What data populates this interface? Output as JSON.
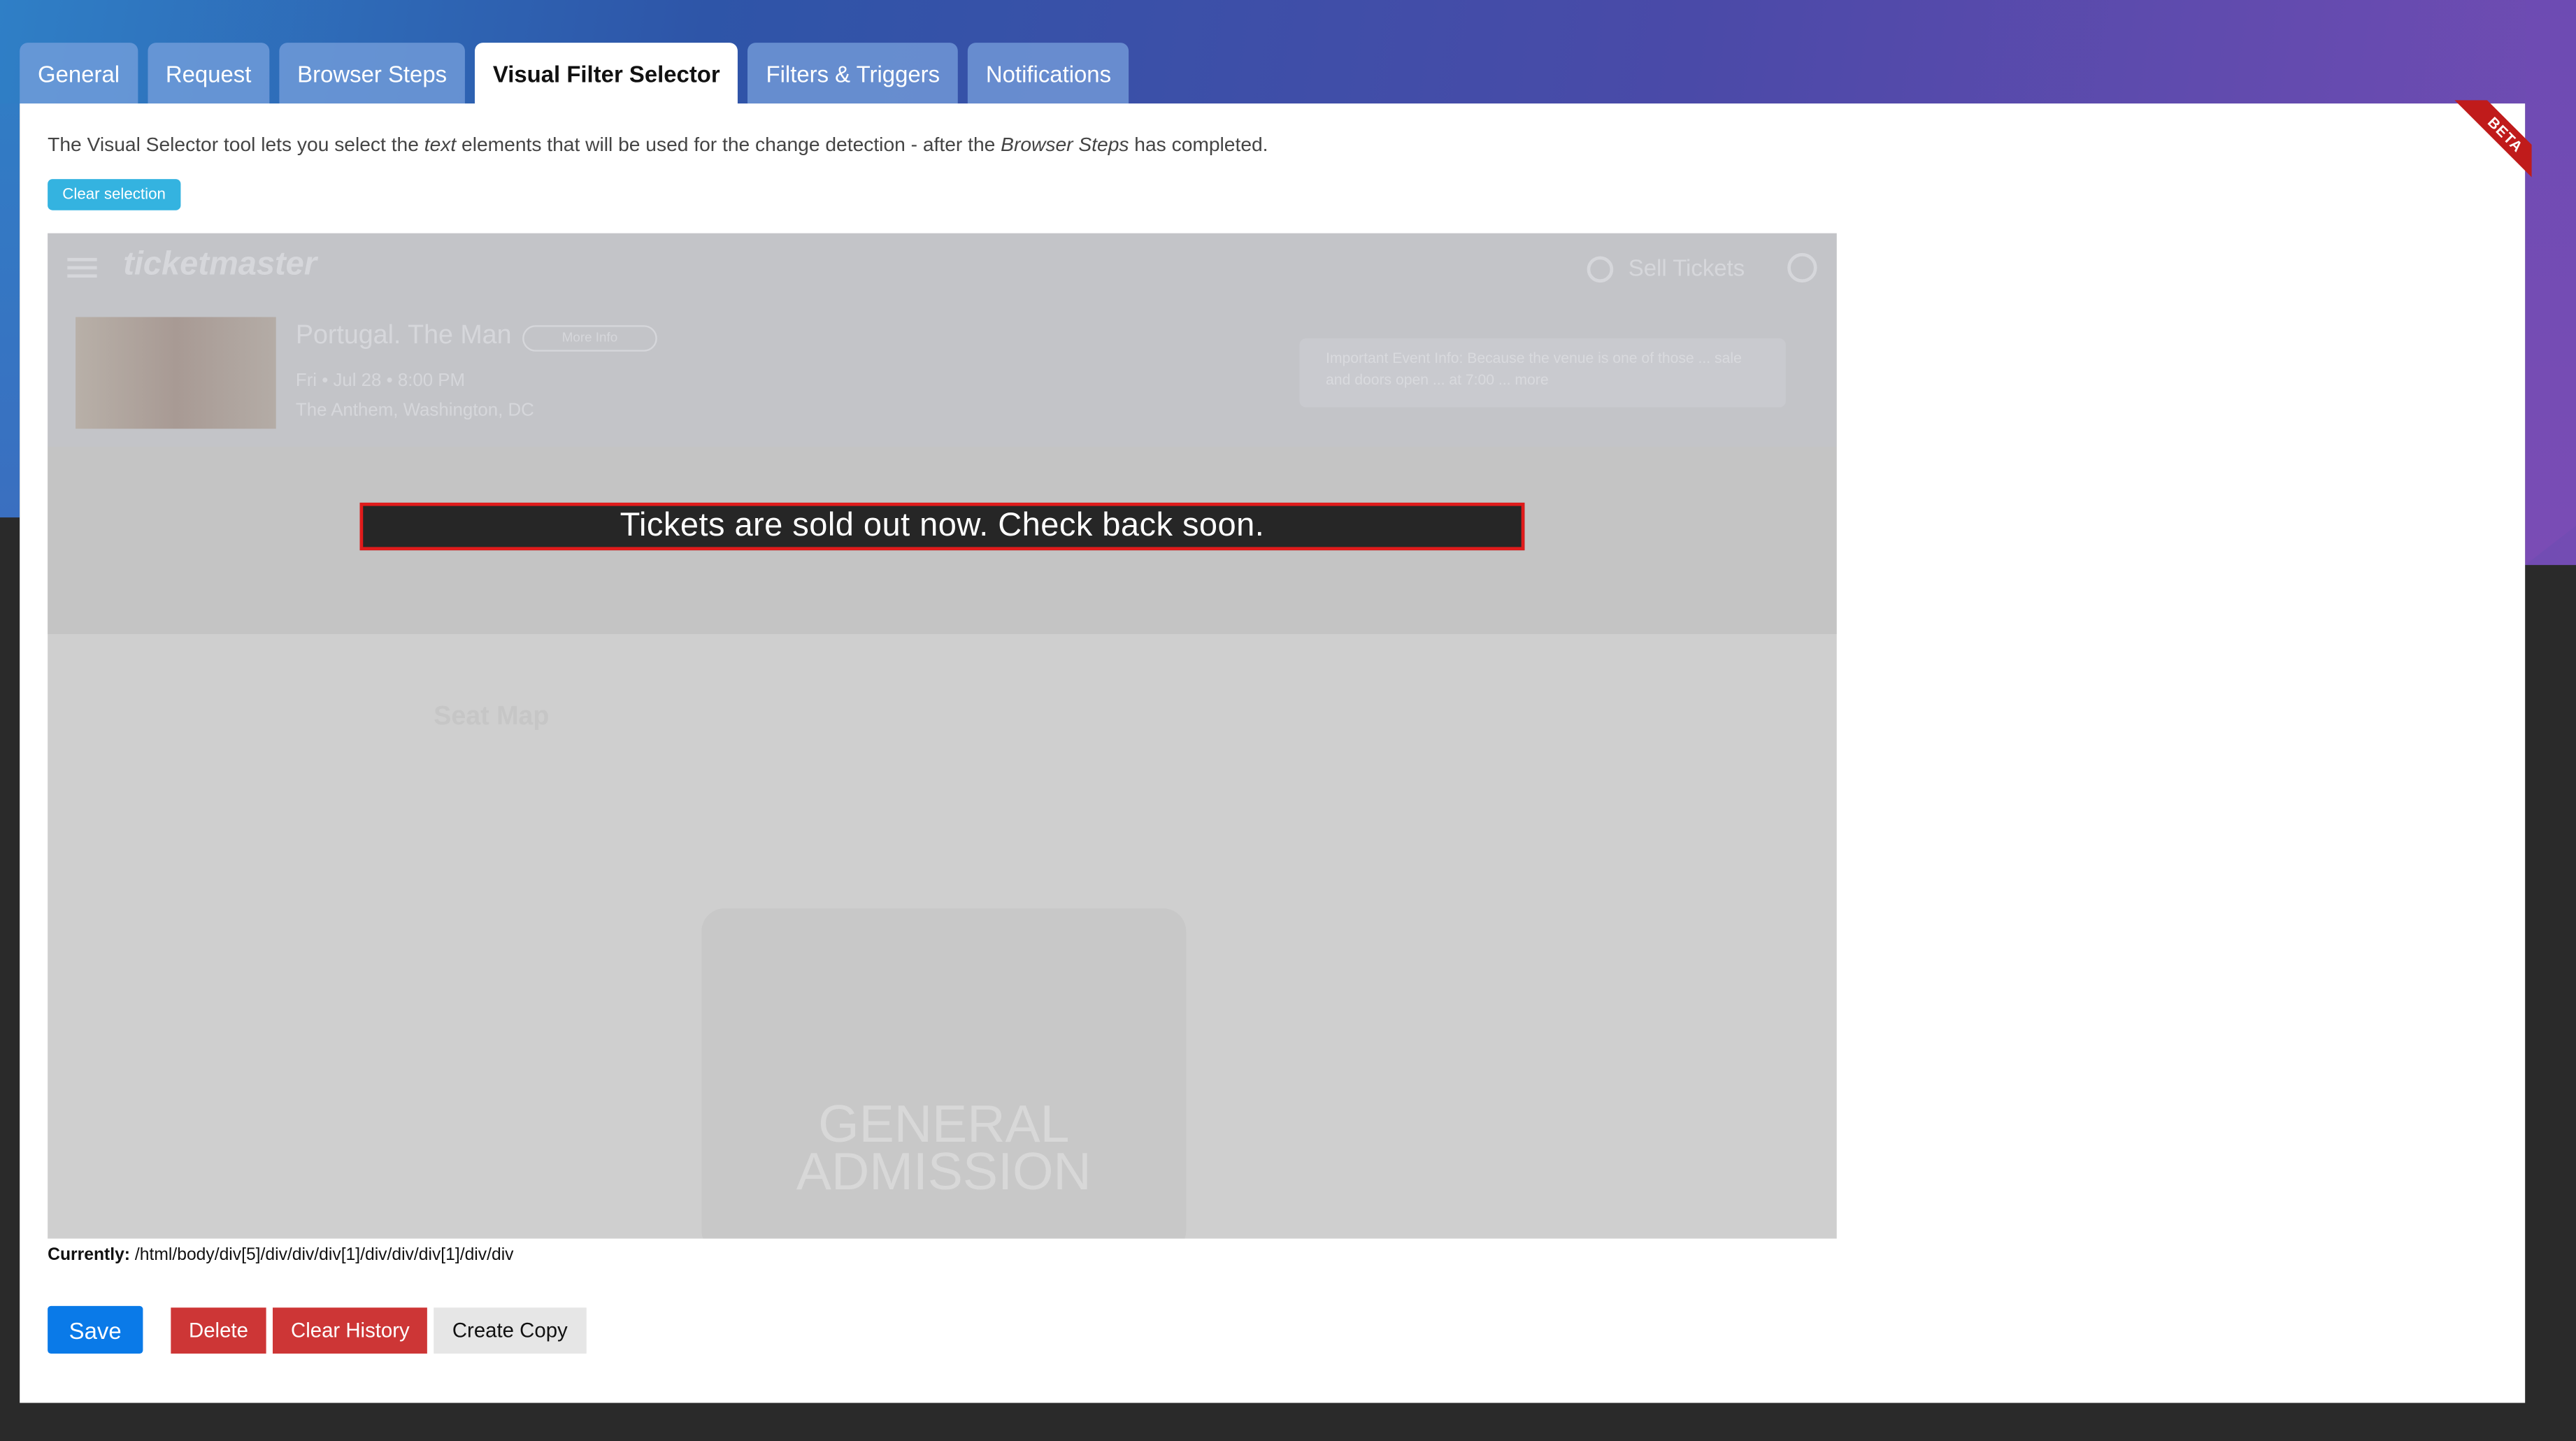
{
  "tabs": [
    {
      "label": "General"
    },
    {
      "label": "Request"
    },
    {
      "label": "Browser Steps"
    },
    {
      "label": "Visual Filter Selector"
    },
    {
      "label": "Filters & Triggers"
    },
    {
      "label": "Notifications"
    }
  ],
  "active_tab": "Visual Filter Selector",
  "beta_label": "BETA",
  "description": {
    "part1": "The Visual Selector tool lets you select the ",
    "italic1": "text",
    "part2": " elements that will be used for the change detection - after the ",
    "italic2": "Browser Steps",
    "part3": " has completed."
  },
  "clear_selection_label": "Clear selection",
  "preview": {
    "logo": "ticketmaster",
    "sell_tickets": "Sell Tickets",
    "event_title": "Portugal. The Man",
    "more_info": "More Info",
    "event_date": "Fri • Jul 28 • 8:00 PM",
    "event_venue": "The Anthem, Washington, DC",
    "event_note": "Important Event Info: Because the venue is one of those ... sale and doors open ... at 7:00 ... more",
    "sold_out_text": "Tickets are sold out now. Check back soon.",
    "seat_map": "Seat Map",
    "general_admission": "GENERAL ADMISSION"
  },
  "currently": {
    "label": "Currently:",
    "xpath": " /html/body/div[5]/div/div/div[1]/div/div/div[1]/div/div"
  },
  "buttons": {
    "save": "Save",
    "delete": "Delete",
    "clear_history": "Clear History",
    "create_copy": "Create Copy"
  },
  "colors": {
    "save": "#0a7ae8",
    "danger": "#cd3636",
    "clear_selection": "#34b3e0",
    "highlight_border": "#e01b1b",
    "beta_ribbon": "#c01b1b"
  }
}
